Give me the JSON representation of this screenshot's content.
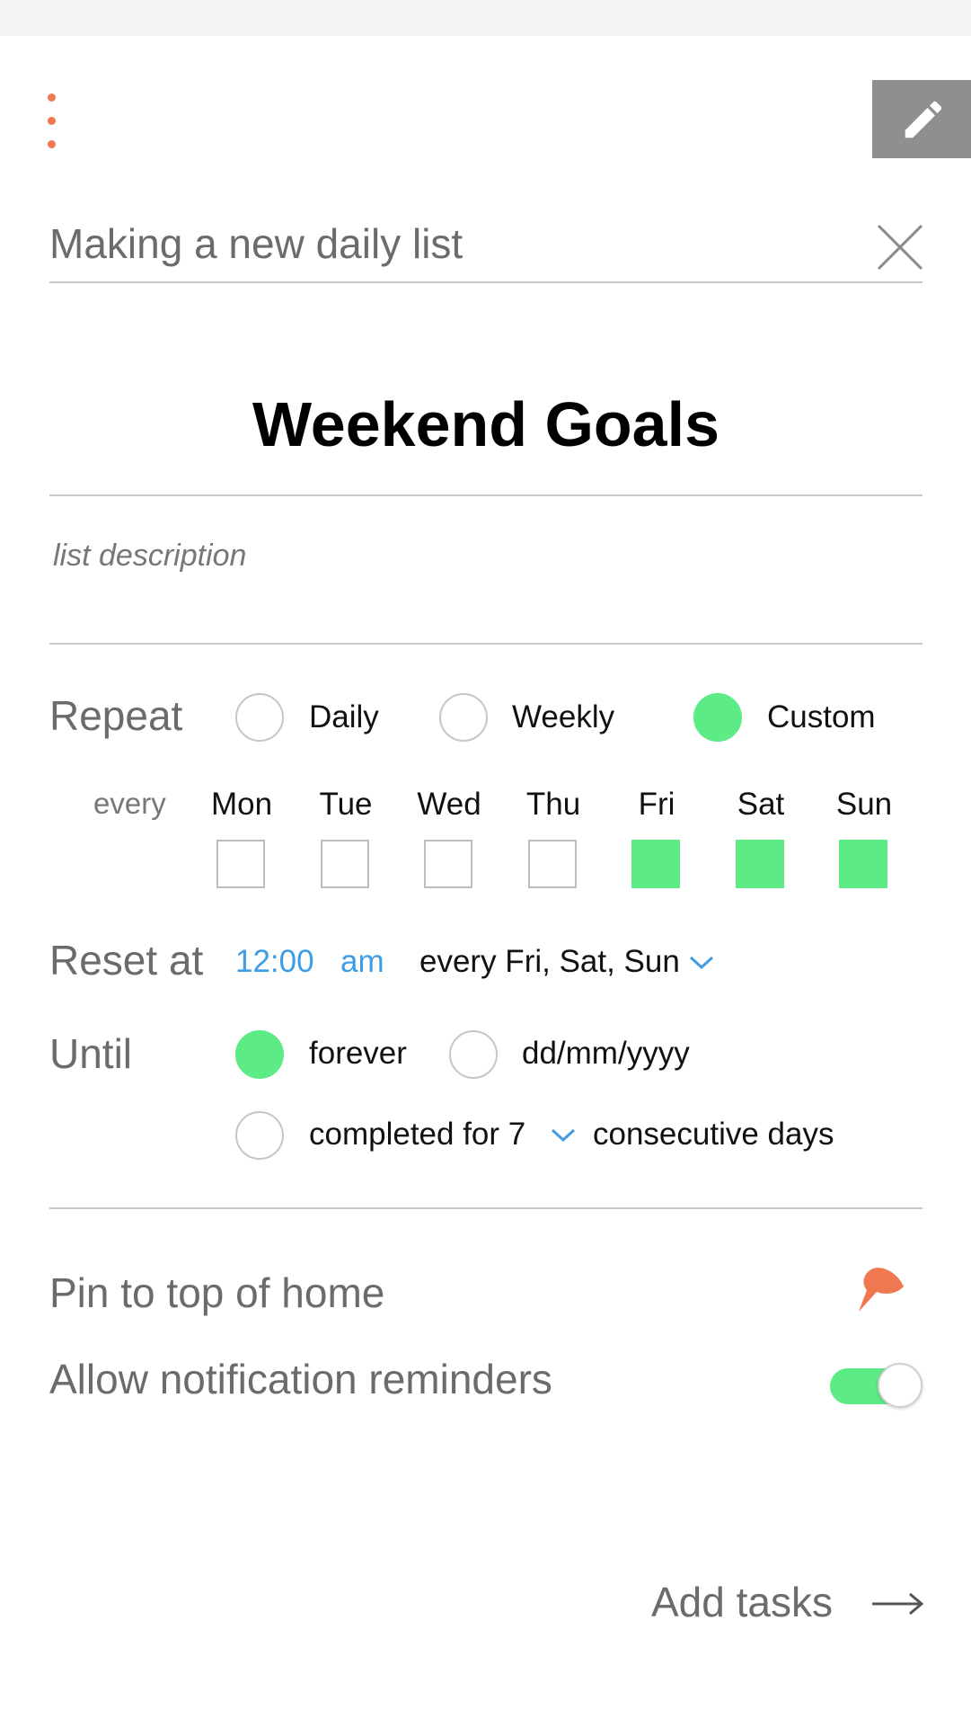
{
  "header": {
    "title": "Making a new daily list",
    "menu_icon": "vertical-dots-icon",
    "edit_icon": "pencil-icon",
    "close_icon": "close-icon"
  },
  "list": {
    "title": "Weekend Goals",
    "description_placeholder": "list description"
  },
  "repeat": {
    "label": "Repeat",
    "options": [
      {
        "label": "Daily",
        "selected": false
      },
      {
        "label": "Weekly",
        "selected": false
      },
      {
        "label": "Custom",
        "selected": true
      }
    ],
    "every_label": "every",
    "days": [
      {
        "label": "Mon",
        "checked": false
      },
      {
        "label": "Tue",
        "checked": false
      },
      {
        "label": "Wed",
        "checked": false
      },
      {
        "label": "Thu",
        "checked": false
      },
      {
        "label": "Fri",
        "checked": true
      },
      {
        "label": "Sat",
        "checked": true
      },
      {
        "label": "Sun",
        "checked": true
      }
    ]
  },
  "reset": {
    "label": "Reset at",
    "time": "12:00",
    "meridiem": "am",
    "schedule": "every Fri, Sat, Sun"
  },
  "until": {
    "label": "Until",
    "forever_label": "forever",
    "forever_selected": true,
    "date_placeholder": "dd/mm/yyyy",
    "date_selected": false,
    "completed_prefix": "completed for 7",
    "completed_suffix": "consecutive days",
    "completed_selected": false
  },
  "settings": {
    "pin_label": "Pin to top of home",
    "pin_icon": "pin-icon",
    "notify_label": "Allow notification reminders",
    "notify_enabled": true
  },
  "footer": {
    "add_tasks_label": "Add tasks",
    "arrow_icon": "arrow-right-icon"
  },
  "colors": {
    "accent_green": "#5ceb85",
    "accent_orange": "#f07850",
    "link_blue": "#3d9de6",
    "edit_button_bg": "#8f8f8f"
  }
}
